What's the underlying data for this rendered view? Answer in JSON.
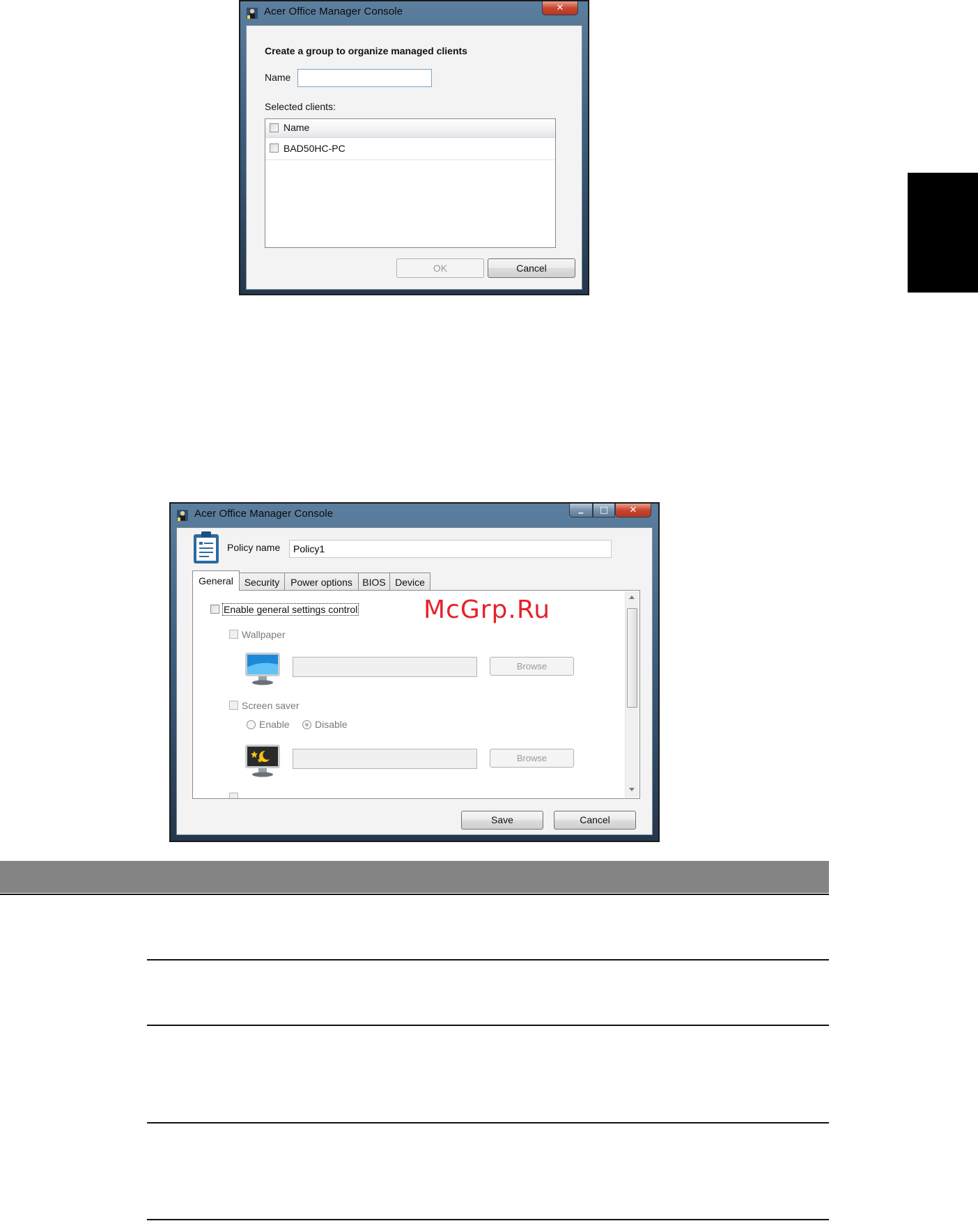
{
  "group_dialog": {
    "window_title": "Acer Office Manager Console",
    "close_symbol": "✕",
    "heading": "Create a group to organize managed clients",
    "name_label": "Name",
    "name_value": "",
    "selected_clients_label": "Selected clients:",
    "list_header": "Name",
    "clients": [
      {
        "name": "BAD50HC-PC",
        "checked": false
      }
    ],
    "ok_label": "OK",
    "cancel_label": "Cancel"
  },
  "policy_dialog": {
    "window_title": "Acer Office Manager Console",
    "min_symbol": "▁",
    "max_symbol": "□",
    "close_symbol": "✕",
    "policy_name_label": "Policy name",
    "policy_name_value": "Policy1",
    "tabs": [
      "General",
      "Security",
      "Power options",
      "BIOS",
      "Device"
    ],
    "active_tab": "General",
    "enable_general_label": "Enable general settings control",
    "wallpaper_label": "Wallpaper",
    "browse_label": "Browse",
    "screen_saver_label": "Screen saver",
    "enable_label": "Enable",
    "disable_label": "Disable",
    "save_label": "Save",
    "cancel_label": "Cancel"
  },
  "watermark": "McGrp.Ru",
  "icons": [
    "app-icon",
    "policy-clipboard-icon",
    "wallpaper-monitor-icon",
    "screensaver-monitor-icon"
  ]
}
